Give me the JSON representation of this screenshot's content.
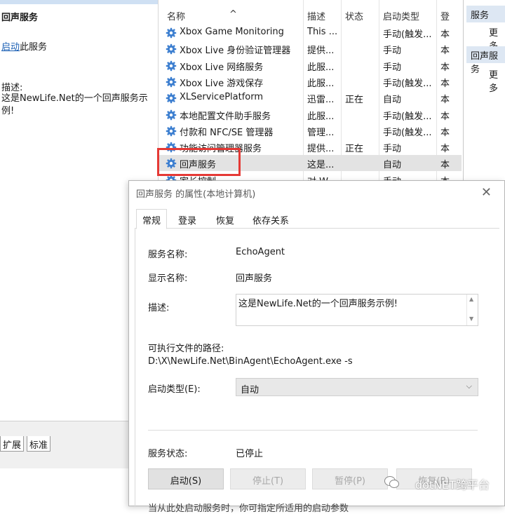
{
  "left_pane": {
    "title": "回声服务",
    "start_link": "启动",
    "start_suffix": "此服务",
    "desc_label": "描述:",
    "desc_text": "这是NewLife.Net的一个回声服务示例!",
    "tabs": [
      "扩展",
      "标准"
    ]
  },
  "list": {
    "columns": [
      "名称",
      "描述",
      "状态",
      "启动类型",
      "登"
    ],
    "rows": [
      {
        "name": "Xbox Game Monitoring",
        "desc": "This ...",
        "status": "",
        "startup": "手动(触发...",
        "logon": "本"
      },
      {
        "name": "Xbox Live 身份验证管理器",
        "desc": "提供...",
        "status": "",
        "startup": "手动",
        "logon": "本"
      },
      {
        "name": "Xbox Live 网络服务",
        "desc": "此服...",
        "status": "",
        "startup": "手动",
        "logon": "本"
      },
      {
        "name": "Xbox Live 游戏保存",
        "desc": "此服...",
        "status": "",
        "startup": "手动(触发...",
        "logon": "本"
      },
      {
        "name": "XLServicePlatform",
        "desc": "迅雷...",
        "status": "正在",
        "startup": "自动",
        "logon": "本"
      },
      {
        "name": "本地配置文件助手服务",
        "desc": "此服...",
        "status": "",
        "startup": "手动(触发...",
        "logon": "本"
      },
      {
        "name": "付款和 NFC/SE 管理器",
        "desc": "管理...",
        "status": "",
        "startup": "手动(触发...",
        "logon": "本"
      },
      {
        "name": "功能访问管理器服务",
        "desc": "提供...",
        "status": "正在",
        "startup": "手动",
        "logon": "本"
      },
      {
        "name": "回声服务",
        "desc": "这是...",
        "status": "",
        "startup": "自动",
        "logon": "本"
      },
      {
        "name": "家长控制",
        "desc": "对 W...",
        "status": "",
        "startup": "手动",
        "logon": "本"
      }
    ],
    "selected_index": 8
  },
  "actions_pane": {
    "section1": "服务",
    "more1": "更多",
    "section2": "回声服务",
    "more2": "更多"
  },
  "dialog": {
    "title": "回声服务 的属性(本地计算机)",
    "close_glyph": "✕",
    "tabs": [
      "常规",
      "登录",
      "恢复",
      "依存关系"
    ],
    "active_tab": 0,
    "service_name_label": "服务名称:",
    "service_name_value": "EchoAgent",
    "display_name_label": "显示名称:",
    "display_name_value": "回声服务",
    "description_label": "描述:",
    "description_value": "这是NewLife.Net的一个回声服务示例!",
    "path_label": "可执行文件的路径:",
    "path_value": "D:\\X\\NewLife.Net\\BinAgent\\EchoAgent.exe -s",
    "startup_type_label": "启动类型(E):",
    "startup_type_value": "自动",
    "service_status_label": "服务状态:",
    "service_status_value": "已停止",
    "buttons": {
      "start": "启动(S)",
      "stop": "停止(T)",
      "pause": "暂停(P)",
      "resume": "恢复(R)"
    },
    "footer_text": "当从此处启动服务时，你可指定所适用的启动参数"
  },
  "watermark": "dotNET跨平台",
  "colors": {
    "highlight": "#e53935",
    "selected_row": "#e3e3e3",
    "link": "#1a5fb4",
    "gear": "#3d7fd0"
  }
}
